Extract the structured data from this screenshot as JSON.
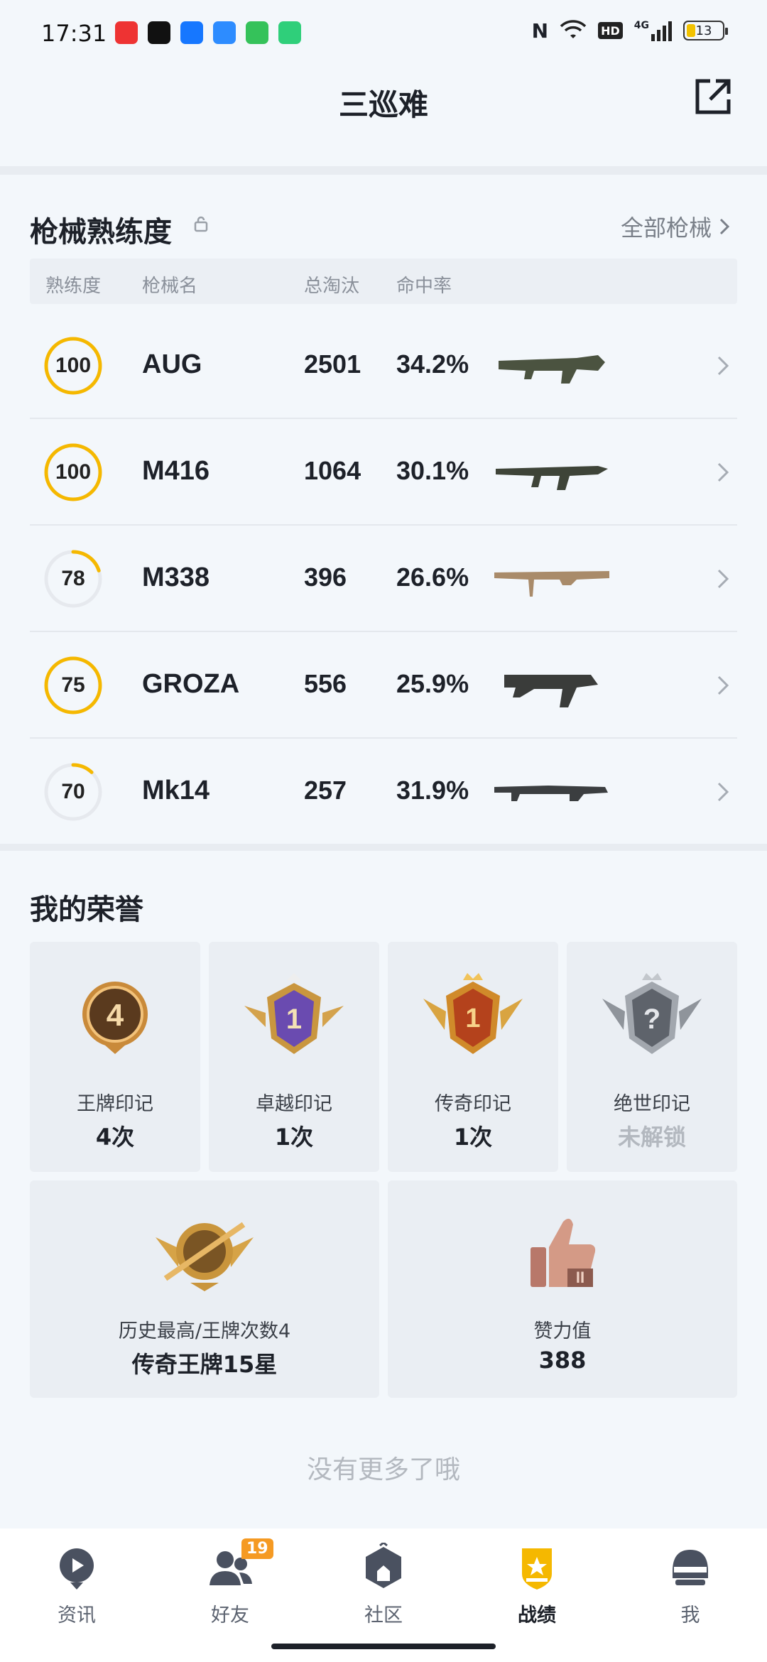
{
  "status_bar": {
    "time": "17:31",
    "network": "4G",
    "battery": "13",
    "hd_label": "HD",
    "nfc_label": "N"
  },
  "header": {
    "title": "三巡难"
  },
  "weapons": {
    "title": "枪械熟练度",
    "all_link": "全部枪械",
    "columns": [
      "熟练度",
      "枪械名",
      "总淘汰",
      "命中率"
    ],
    "rows": [
      {
        "mastery": "100",
        "mastery_value": 100,
        "name": "AUG",
        "kills": "2501",
        "rate": "34.2%"
      },
      {
        "mastery": "100",
        "mastery_value": 100,
        "name": "M416",
        "kills": "1064",
        "rate": "30.1%"
      },
      {
        "mastery": "78",
        "mastery_value": 0.2,
        "name": "M338",
        "kills": "396",
        "rate": "26.6%"
      },
      {
        "mastery": "75",
        "mastery_value": 100,
        "name": "GROZA",
        "kills": "556",
        "rate": "25.9%"
      },
      {
        "mastery": "70",
        "mastery_value": 0.12,
        "name": "Mk14",
        "kills": "257",
        "rate": "31.9%"
      }
    ]
  },
  "honors": {
    "title": "我的荣誉",
    "items": [
      {
        "label": "王牌印记",
        "value": "4次",
        "emblem_text": "4"
      },
      {
        "label": "卓越印记",
        "value": "1次",
        "emblem_text": "1"
      },
      {
        "label": "传奇印记",
        "value": "1次",
        "emblem_text": "1"
      },
      {
        "label": "绝世印记",
        "value": "未解锁",
        "emblem_text": "?"
      }
    ],
    "wide": [
      {
        "label": "历史最高/王牌次数4",
        "value": "传奇王牌15星"
      },
      {
        "label": "赞力值",
        "value": "388"
      }
    ]
  },
  "footer": {
    "no_more": "没有更多了哦"
  },
  "nav": {
    "items": [
      {
        "label": "资讯"
      },
      {
        "label": "好友",
        "badge": "19"
      },
      {
        "label": "社区"
      },
      {
        "label": "战绩"
      },
      {
        "label": "我"
      }
    ]
  },
  "colors": {
    "ring_gold": "#f5b800",
    "ring_track": "#e6e9ee",
    "nav_active": "#f5b800"
  }
}
